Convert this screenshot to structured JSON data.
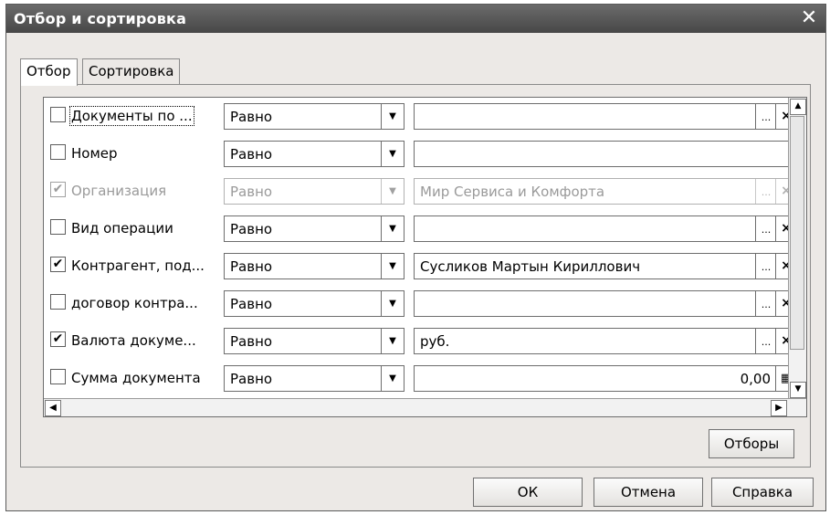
{
  "window": {
    "title": "Отбор и сортировка",
    "close_glyph": "✕"
  },
  "tabs": [
    {
      "label": "Отбор",
      "active": true
    },
    {
      "label": "Сортировка",
      "active": false
    }
  ],
  "filters": [
    {
      "checked": false,
      "label": "Документы по ...",
      "condition": "Равно",
      "value": "",
      "buttons": [
        "...",
        "×"
      ],
      "disabled": false
    },
    {
      "checked": false,
      "label": "Номер",
      "condition": "Равно",
      "value": "",
      "buttons": [],
      "disabled": false
    },
    {
      "checked": true,
      "label": "Организация",
      "condition": "Равно",
      "value": "Мир Сервиса и Комфорта",
      "buttons": [
        "...",
        "×"
      ],
      "disabled": true
    },
    {
      "checked": false,
      "label": "Вид операции",
      "condition": "Равно",
      "value": "",
      "buttons": [
        "...",
        "×"
      ],
      "disabled": false
    },
    {
      "checked": true,
      "label": "Контрагент, под...",
      "condition": "Равно",
      "value": "Сусликов Мартын Кириллович",
      "buttons": [
        "...",
        "×"
      ],
      "disabled": false
    },
    {
      "checked": false,
      "label": "договор контра...",
      "condition": "Равно",
      "value": "",
      "buttons": [
        "...",
        "×"
      ],
      "disabled": false
    },
    {
      "checked": true,
      "label": "Валюта докуме...",
      "condition": "Равно",
      "value": "руб.",
      "buttons": [
        "...",
        "×"
      ],
      "disabled": false
    },
    {
      "checked": false,
      "label": "Сумма документа",
      "condition": "Равно",
      "value": "0,00",
      "buttons": [
        "calc"
      ],
      "disabled": false
    }
  ],
  "icons": {
    "dropdown": "▼",
    "check": "✔",
    "scroll_up": "▲",
    "scroll_down": "▼",
    "scroll_left": "◀",
    "scroll_right": "▶",
    "calculator": "▦"
  },
  "buttons": {
    "filters": "Отборы",
    "ok": "ОК",
    "cancel": "Отмена",
    "help": "Справка"
  }
}
